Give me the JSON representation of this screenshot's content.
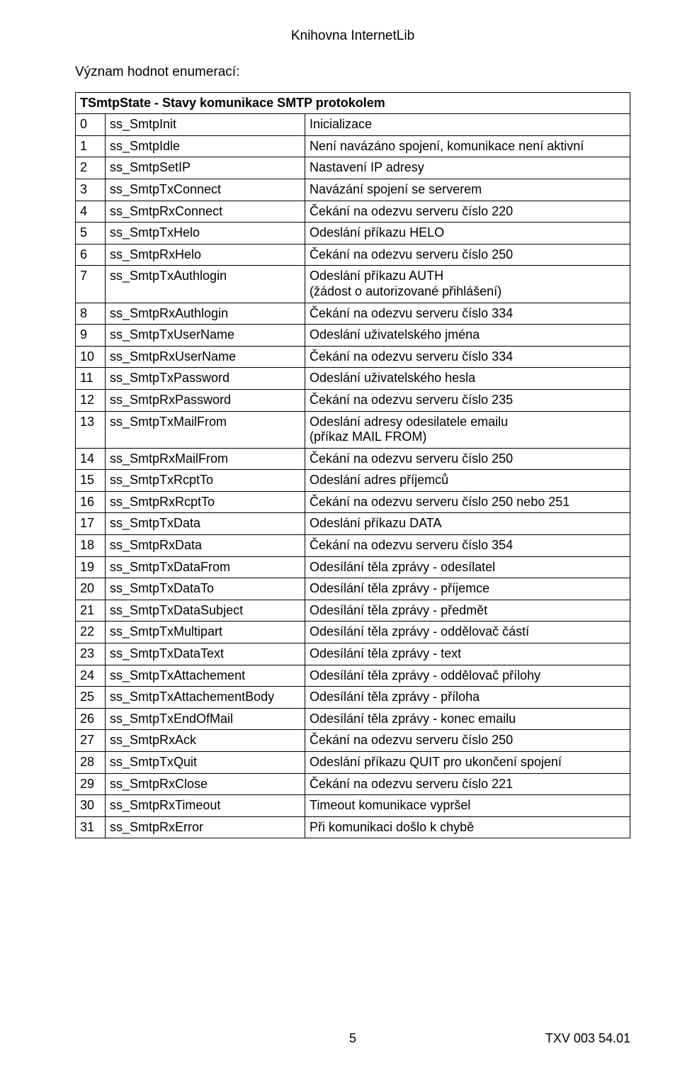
{
  "header": {
    "title": "Knihovna InternetLib"
  },
  "intro": "Význam hodnot enumerací:",
  "table": {
    "caption": "TSmtpState - Stavy komunikace SMTP protokolem",
    "rows": [
      {
        "n": "0",
        "id": "ss_SmtpInit",
        "desc": "Inicializace"
      },
      {
        "n": "1",
        "id": "ss_SmtpIdle",
        "desc": "Není navázáno spojení, komunikace není aktivní"
      },
      {
        "n": "2",
        "id": "ss_SmtpSetIP",
        "desc": "Nastavení IP adresy"
      },
      {
        "n": "3",
        "id": "ss_SmtpTxConnect",
        "desc": "Navázání spojení se serverem"
      },
      {
        "n": "4",
        "id": "ss_SmtpRxConnect",
        "desc": "Čekání na odezvu serveru číslo 220"
      },
      {
        "n": "5",
        "id": "ss_SmtpTxHelo",
        "desc": "Odeslání příkazu HELO"
      },
      {
        "n": "6",
        "id": "ss_SmtpRxHelo",
        "desc": "Čekání na odezvu serveru číslo 250"
      },
      {
        "n": "7",
        "id": "ss_SmtpTxAuthlogin",
        "desc": "Odeslání příkazu AUTH\n(žádost o autorizované přihlášení)"
      },
      {
        "n": "8",
        "id": "ss_SmtpRxAuthlogin",
        "desc": "Čekání na odezvu serveru číslo 334"
      },
      {
        "n": "9",
        "id": "ss_SmtpTxUserName",
        "desc": "Odeslání uživatelského jména"
      },
      {
        "n": "10",
        "id": "ss_SmtpRxUserName",
        "desc": "Čekání na odezvu serveru číslo 334"
      },
      {
        "n": "11",
        "id": "ss_SmtpTxPassword",
        "desc": "Odeslání uživatelského hesla"
      },
      {
        "n": "12",
        "id": "ss_SmtpRxPassword",
        "desc": "Čekání na odezvu serveru číslo 235"
      },
      {
        "n": "13",
        "id": "ss_SmtpTxMailFrom",
        "desc": "Odeslání adresy odesilatele emailu\n(příkaz MAIL FROM)"
      },
      {
        "n": "14",
        "id": "ss_SmtpRxMailFrom",
        "desc": "Čekání na odezvu serveru číslo 250"
      },
      {
        "n": "15",
        "id": "ss_SmtpTxRcptTo",
        "desc": "Odeslání adres příjemců"
      },
      {
        "n": "16",
        "id": "ss_SmtpRxRcptTo",
        "desc": "Čekání na odezvu serveru číslo 250 nebo 251"
      },
      {
        "n": "17",
        "id": "ss_SmtpTxData",
        "desc": "Odeslání příkazu DATA"
      },
      {
        "n": "18",
        "id": "ss_SmtpRxData",
        "desc": "Čekání na odezvu serveru číslo 354"
      },
      {
        "n": "19",
        "id": "ss_SmtpTxDataFrom",
        "desc": "Odesílání těla zprávy - odesílatel"
      },
      {
        "n": "20",
        "id": "ss_SmtpTxDataTo",
        "desc": "Odesílání těla zprávy - příjemce"
      },
      {
        "n": "21",
        "id": "ss_SmtpTxDataSubject",
        "desc": "Odesílání těla zprávy - předmět"
      },
      {
        "n": "22",
        "id": "ss_SmtpTxMultipart",
        "desc": "Odesílání těla zprávy - oddělovač částí"
      },
      {
        "n": "23",
        "id": "ss_SmtpTxDataText",
        "desc": "Odesílání těla zprávy - text"
      },
      {
        "n": "24",
        "id": "ss_SmtpTxAttachement",
        "desc": "Odesílání těla zprávy - oddělovač přílohy"
      },
      {
        "n": "25",
        "id": "ss_SmtpTxAttachementBody",
        "desc": "Odesílání těla zprávy - příloha"
      },
      {
        "n": "26",
        "id": "ss_SmtpTxEndOfMail",
        "desc": "Odesílání těla zprávy - konec emailu"
      },
      {
        "n": "27",
        "id": "ss_SmtpRxAck",
        "desc": "Čekání na odezvu serveru číslo 250"
      },
      {
        "n": "28",
        "id": "ss_SmtpTxQuit",
        "desc": "Odeslání příkazu QUIT pro ukončení spojení"
      },
      {
        "n": "29",
        "id": "ss_SmtpRxClose",
        "desc": "Čekání na odezvu serveru číslo 221"
      },
      {
        "n": "30",
        "id": "ss_SmtpRxTimeout",
        "desc": "Timeout komunikace vypršel"
      },
      {
        "n": "31",
        "id": "ss_SmtpRxError",
        "desc": "Při komunikaci došlo k chybě"
      }
    ]
  },
  "footer": {
    "page": "5",
    "docid": "TXV 003 54.01"
  }
}
